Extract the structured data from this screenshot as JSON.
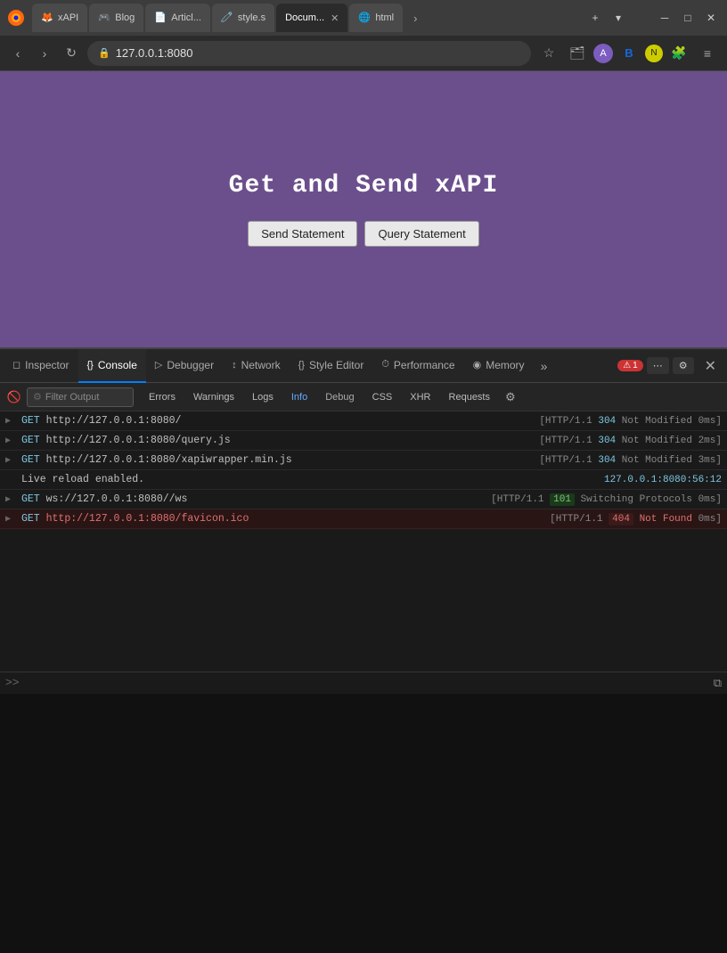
{
  "browser": {
    "title_bar": {
      "tabs": [
        {
          "id": "tab-xapi",
          "label": "xAPI",
          "favicon": "🦊",
          "active": false,
          "closeable": false
        },
        {
          "id": "tab-blog",
          "label": "Blog",
          "favicon": "🎮",
          "active": false,
          "closeable": false
        },
        {
          "id": "tab-article",
          "label": "Articl...",
          "favicon": "📄",
          "active": false,
          "closeable": false
        },
        {
          "id": "tab-style",
          "label": "style.s",
          "favicon": "🧷",
          "active": false,
          "closeable": false
        },
        {
          "id": "tab-document",
          "label": "Docum...",
          "favicon": "",
          "active": true,
          "closeable": true
        },
        {
          "id": "tab-html",
          "label": "html",
          "favicon": "🌐",
          "active": false,
          "closeable": false
        }
      ],
      "new_tab_label": "+",
      "more_tabs_label": "▾",
      "minimize_label": "─",
      "maximize_label": "□",
      "close_label": "✕"
    },
    "nav_bar": {
      "back_label": "‹",
      "forward_label": "›",
      "reload_label": "↻",
      "address": "127.0.0.1:8080",
      "bookmark_label": "☆",
      "shield_label": "🛡",
      "bitwarden_label": "B",
      "norton_label": "N",
      "extensions_label": "🧩",
      "menu_label": "≡"
    }
  },
  "page": {
    "title": "Get and Send xAPI",
    "send_button_label": "Send Statement",
    "query_button_label": "Query Statement",
    "cursor_visible": true
  },
  "devtools": {
    "tabs": [
      {
        "id": "inspector",
        "label": "Inspector",
        "icon": "◻"
      },
      {
        "id": "console",
        "label": "Console",
        "icon": "{}"
      },
      {
        "id": "debugger",
        "label": "Debugger",
        "icon": "▷"
      },
      {
        "id": "network",
        "label": "Network",
        "icon": "↕"
      },
      {
        "id": "style-editor",
        "label": "Style Editor",
        "icon": "{}"
      },
      {
        "id": "performance",
        "label": "Performance",
        "icon": "⏱"
      },
      {
        "id": "memory",
        "label": "Memory",
        "icon": "◉"
      }
    ],
    "active_tab": "console",
    "more_label": "»",
    "error_badge": "1",
    "error_icon": "⚠",
    "more_tools_label": "⋯",
    "settings_label": "⚙",
    "close_label": "✕",
    "console": {
      "clear_label": "🚫",
      "filter_placeholder": "Filter Output",
      "filter_icon": "⚙",
      "filter_buttons": [
        {
          "id": "errors",
          "label": "Errors",
          "active": false
        },
        {
          "id": "warnings",
          "label": "Warnings",
          "active": false
        },
        {
          "id": "logs",
          "label": "Logs",
          "active": false
        },
        {
          "id": "info",
          "label": "Info",
          "active": false
        },
        {
          "id": "debug",
          "label": "Debug",
          "active": false
        },
        {
          "id": "css",
          "label": "CSS",
          "active": false
        },
        {
          "id": "xhr",
          "label": "XHR",
          "active": false
        },
        {
          "id": "requests",
          "label": "Requests",
          "active": false
        }
      ],
      "settings_btn_label": "⚙",
      "log_entries": [
        {
          "id": "entry1",
          "type": "network",
          "method": "GET",
          "url": "http://127.0.0.1:8080/",
          "meta": "[HTTP/1.1 304 Not Modified 0ms]",
          "status_code": "304",
          "status_text": "Not Modified",
          "timing": "0ms",
          "has_error": false
        },
        {
          "id": "entry2",
          "type": "network",
          "method": "GET",
          "url": "http://127.0.0.1:8080/query.js",
          "meta": "[HTTP/1.1 304 Not Modified 2ms]",
          "status_code": "304",
          "status_text": "Not Modified",
          "timing": "2ms",
          "has_error": false
        },
        {
          "id": "entry3",
          "type": "network",
          "method": "GET",
          "url": "http://127.0.0.1:8080/xapiwrapper.min.js",
          "meta": "[HTTP/1.1 304 Not Modified 3ms]",
          "status_code": "304",
          "status_text": "Not Modified",
          "timing": "3ms",
          "has_error": false
        },
        {
          "id": "entry-reload",
          "type": "text",
          "message": "Live reload enabled.",
          "source": "127.0.0.1:8080:56:12",
          "has_error": false
        },
        {
          "id": "entry4",
          "type": "network",
          "method": "GET",
          "url": "ws://127.0.0.1:8080//ws",
          "meta": "[HTTP/1.1 101 Switching Protocols 0ms]",
          "status_code": "101",
          "status_text": "Switching Protocols",
          "timing": "0ms",
          "has_error": false
        },
        {
          "id": "entry5",
          "type": "network",
          "method": "GET",
          "url": "http://127.0.0.1:8080/favicon.ico",
          "meta": "[HTTP/1.1 404 Not Found 0ms]",
          "status_code": "404",
          "status_text": "Not Found",
          "timing": "0ms",
          "has_error": true
        }
      ],
      "console_prompt": ">>",
      "split_console_label": "⧉"
    }
  }
}
